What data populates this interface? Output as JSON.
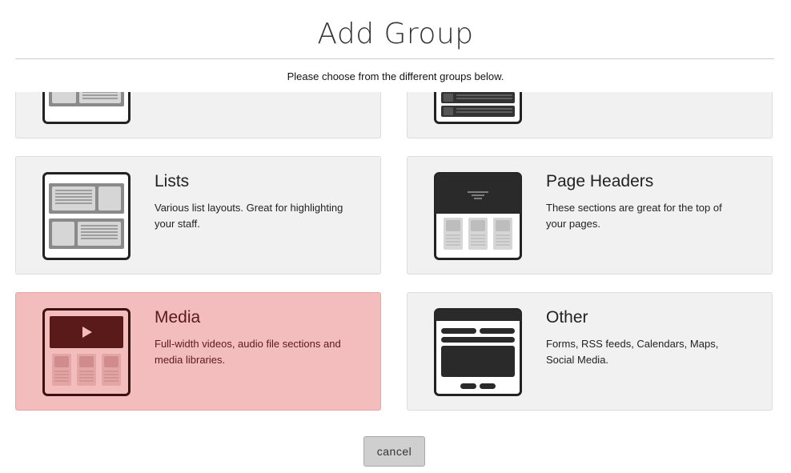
{
  "dialog": {
    "title": "Add Group",
    "subtitle": "Please choose from the different groups below."
  },
  "groups": [
    {
      "id": "partial-left",
      "title": "",
      "description": ""
    },
    {
      "id": "partial-right",
      "title": "",
      "description": ""
    },
    {
      "id": "lists",
      "title": "Lists",
      "description": "Various list layouts. Great for highlighting your staff."
    },
    {
      "id": "page-headers",
      "title": "Page Headers",
      "description": "These sections are great for the top of your pages."
    },
    {
      "id": "media",
      "title": "Media",
      "description": "Full-width videos, audio file sections and media libraries.",
      "highlighted": true
    },
    {
      "id": "other",
      "title": "Other",
      "description": "Forms, RSS feeds, Calendars, Maps, Social Media."
    }
  ],
  "colors": {
    "card_bg": "#f1f1f1",
    "highlight_bg": "#f4bdbd",
    "icon_dark": "#222222",
    "media_icon_dark": "#5a1a1a"
  },
  "footer": {
    "cancel_label": "cancel"
  }
}
